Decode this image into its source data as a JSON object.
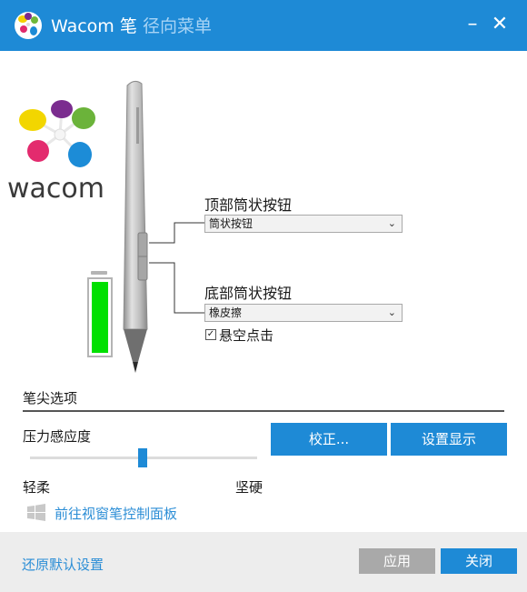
{
  "title": {
    "app": "Wacom 笔",
    "subtitle": "径向菜单"
  },
  "window_controls": {
    "minimize": "–",
    "close": "✕"
  },
  "logo": {
    "wordmark": "wacom"
  },
  "battery": {
    "level_percent": 100,
    "fill_color": "#00e000"
  },
  "pen_buttons": {
    "top": {
      "label": "顶部筒状按钮",
      "value": "筒状按钮"
    },
    "bottom": {
      "label": "底部筒状按钮",
      "value": "橡皮擦"
    },
    "hover_click": {
      "label": "悬空点击",
      "checked": true,
      "mark": "✓"
    }
  },
  "tip_options": {
    "section_title": "笔尖选项",
    "pressure_label": "压力感应度",
    "soft_label": "轻柔",
    "firm_label": "坚硬",
    "pressure_level_fraction": 0.5,
    "calibrate_button": "校正...",
    "display_settings_button": "设置显示"
  },
  "windows_link": {
    "label": "前往视窗笔控制面板",
    "icon": "windows-logo-icon"
  },
  "footer": {
    "restore_defaults": "还原默认设置",
    "apply_button": "应用",
    "close_button": "关闭"
  },
  "colors": {
    "accent": "#1e8ad6",
    "disabled": "#a9a9a9",
    "link": "#2c8ed6"
  }
}
